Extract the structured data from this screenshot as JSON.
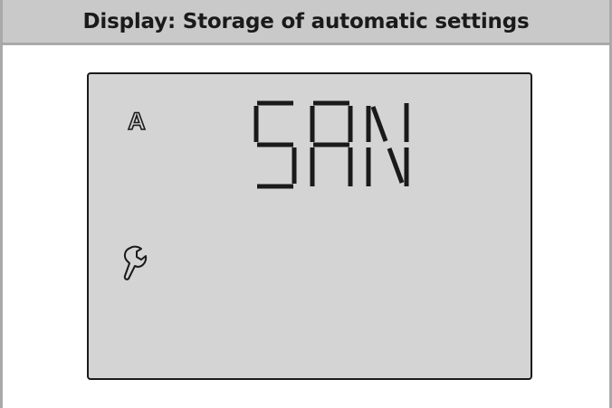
{
  "header": {
    "title": "Display: Storage of automatic settings"
  },
  "lcd": {
    "readout": "SAN",
    "mode_indicator": "A",
    "icons": {
      "mode": "outlined-a-icon",
      "service": "wrench-icon"
    }
  },
  "colors": {
    "header_bg": "#c9c9c9",
    "frame": "#a9a9a9",
    "lcd_bg": "#d4d4d4",
    "segment": "#1a1a1a"
  }
}
